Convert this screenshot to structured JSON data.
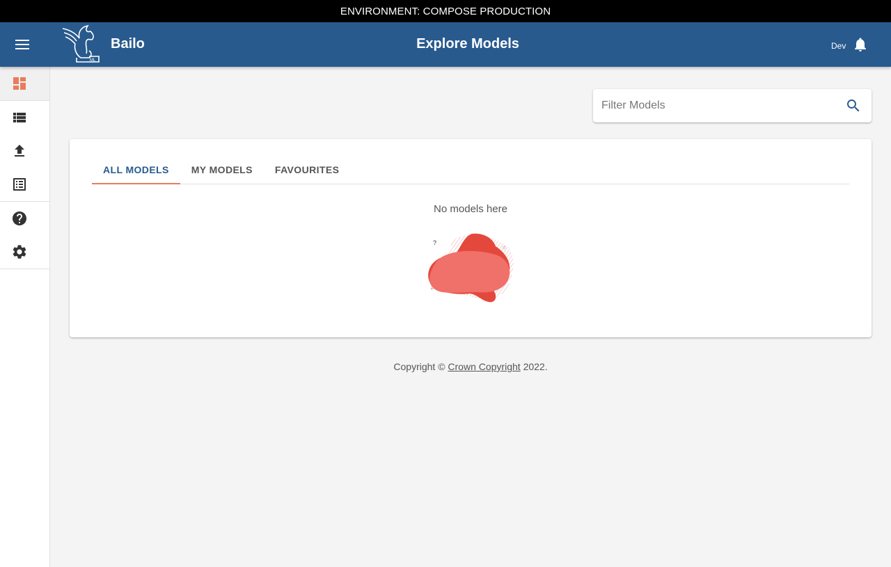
{
  "environment_banner": "ENVIRONMENT: COMPOSE PRODUCTION",
  "appbar": {
    "brand": "Bailo",
    "title": "Explore Models",
    "user": "Dev",
    "color": "#285a8e"
  },
  "sidebar": {
    "items": [
      {
        "icon": "dashboard-icon",
        "active": true
      },
      {
        "icon": "list-icon",
        "active": false
      },
      {
        "icon": "upload-icon",
        "active": false
      },
      {
        "icon": "review-list-icon",
        "active": false
      },
      {
        "icon": "help-icon",
        "active": false
      },
      {
        "icon": "settings-icon",
        "active": false
      }
    ]
  },
  "search": {
    "placeholder": "Filter Models",
    "value": ""
  },
  "tabs": [
    {
      "label": "ALL MODELS",
      "active": true
    },
    {
      "label": "MY MODELS",
      "active": false
    },
    {
      "label": "FAVOURITES",
      "active": false
    }
  ],
  "empty_state": {
    "message": "No models here"
  },
  "footer": {
    "prefix": "Copyright ©",
    "link": "Crown Copyright",
    "suffix": "2022."
  },
  "colors": {
    "accent": "#e97c5e",
    "primary": "#285a8e",
    "banner": "#000000"
  }
}
